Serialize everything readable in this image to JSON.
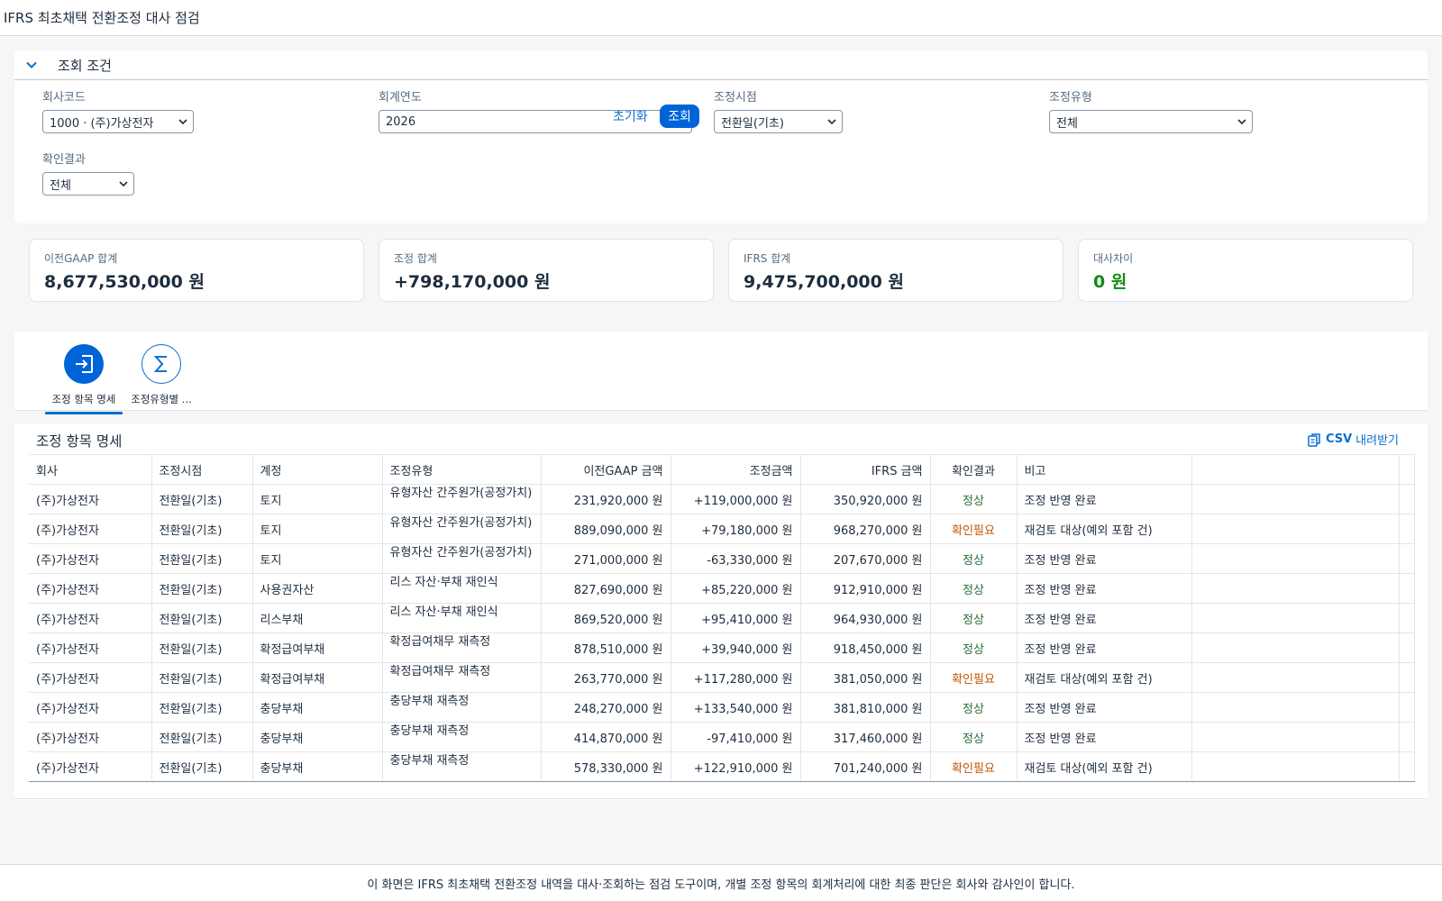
{
  "app": {
    "title": "IFRS 최초채택 전환조정 대사 점검"
  },
  "filter": {
    "header_label": "조회 조건",
    "company": {
      "label": "회사코드",
      "value": "1000 · (주)가상전자"
    },
    "year": {
      "label": "회계연도",
      "value": "2026"
    },
    "timing": {
      "label": "조정시점",
      "value": "전환일(기초)"
    },
    "type": {
      "label": "조정유형",
      "value": "전체"
    },
    "result": {
      "label": "확인결과",
      "value": "전체"
    },
    "reset_label": "초기화",
    "search_label": "조회"
  },
  "kpis": [
    {
      "label": "이전GAAP 합계",
      "value": "8,677,530,000 원"
    },
    {
      "label": "조정 합계",
      "value": "+798,170,000 원"
    },
    {
      "label": "IFRS 합계",
      "value": "9,475,700,000 원"
    },
    {
      "label": "대사차이",
      "value": "0 원",
      "color": "#188918"
    }
  ],
  "tabs": [
    {
      "label": "조정 항목 명세",
      "icon": "enter-icon",
      "active": true
    },
    {
      "label": "조정유형별 ...",
      "icon": "sum-icon",
      "active": false
    }
  ],
  "table": {
    "title": "조정 항목 명세",
    "csv_label_strong": "CSV",
    "csv_label": "내려받기",
    "columns": [
      "회사",
      "조정시점",
      "계정",
      "조정유형",
      "이전GAAP 금액",
      "조정금액",
      "IFRS 금액",
      "확인결과",
      "비고"
    ],
    "rows": [
      [
        "(주)가상전자",
        "전환일(기초)",
        "토지",
        "유형자산 간주원가(공정가치)",
        "231,920,000 원",
        "+119,000,000 원",
        "350,920,000 원",
        "정상",
        "조정 반영 완료"
      ],
      [
        "(주)가상전자",
        "전환일(기초)",
        "토지",
        "유형자산 간주원가(공정가치)",
        "889,090,000 원",
        "+79,180,000 원",
        "968,270,000 원",
        "확인필요",
        "재검토 대상(예외 포함 건)"
      ],
      [
        "(주)가상전자",
        "전환일(기초)",
        "토지",
        "유형자산 간주원가(공정가치)",
        "271,000,000 원",
        "-63,330,000 원",
        "207,670,000 원",
        "정상",
        "조정 반영 완료"
      ],
      [
        "(주)가상전자",
        "전환일(기초)",
        "사용권자산",
        "리스 자산·부채 재인식",
        "827,690,000 원",
        "+85,220,000 원",
        "912,910,000 원",
        "정상",
        "조정 반영 완료"
      ],
      [
        "(주)가상전자",
        "전환일(기초)",
        "리스부채",
        "리스 자산·부채 재인식",
        "869,520,000 원",
        "+95,410,000 원",
        "964,930,000 원",
        "정상",
        "조정 반영 완료"
      ],
      [
        "(주)가상전자",
        "전환일(기초)",
        "확정급여부채",
        "확정급여채무 재측정",
        "878,510,000 원",
        "+39,940,000 원",
        "918,450,000 원",
        "정상",
        "조정 반영 완료"
      ],
      [
        "(주)가상전자",
        "전환일(기초)",
        "확정급여부채",
        "확정급여채무 재측정",
        "263,770,000 원",
        "+117,280,000 원",
        "381,050,000 원",
        "확인필요",
        "재검토 대상(예외 포함 건)"
      ],
      [
        "(주)가상전자",
        "전환일(기초)",
        "충당부채",
        "충당부채 재측정",
        "248,270,000 원",
        "+133,540,000 원",
        "381,810,000 원",
        "정상",
        "조정 반영 완료"
      ],
      [
        "(주)가상전자",
        "전환일(기초)",
        "충당부채",
        "충당부채 재측정",
        "414,870,000 원",
        "-97,410,000 원",
        "317,460,000 원",
        "정상",
        "조정 반영 완료"
      ],
      [
        "(주)가상전자",
        "전환일(기초)",
        "충당부채",
        "충당부채 재측정",
        "578,330,000 원",
        "+122,910,000 원",
        "701,240,000 원",
        "확인필요",
        "재검토 대상(예외 포함 건)"
      ]
    ]
  },
  "colors": {
    "accent": "#0064d9",
    "ok": "#256f3a",
    "warn": "#c35500",
    "diff_ok": "#188918"
  },
  "footer": {
    "text": "이 화면은 IFRS 최초채택 전환조정 내역을 대사·조회하는 점검 도구이며, 개별 조정 항목의 회계처리에 대한 최종 판단은 회사와 감사인이 합니다."
  }
}
